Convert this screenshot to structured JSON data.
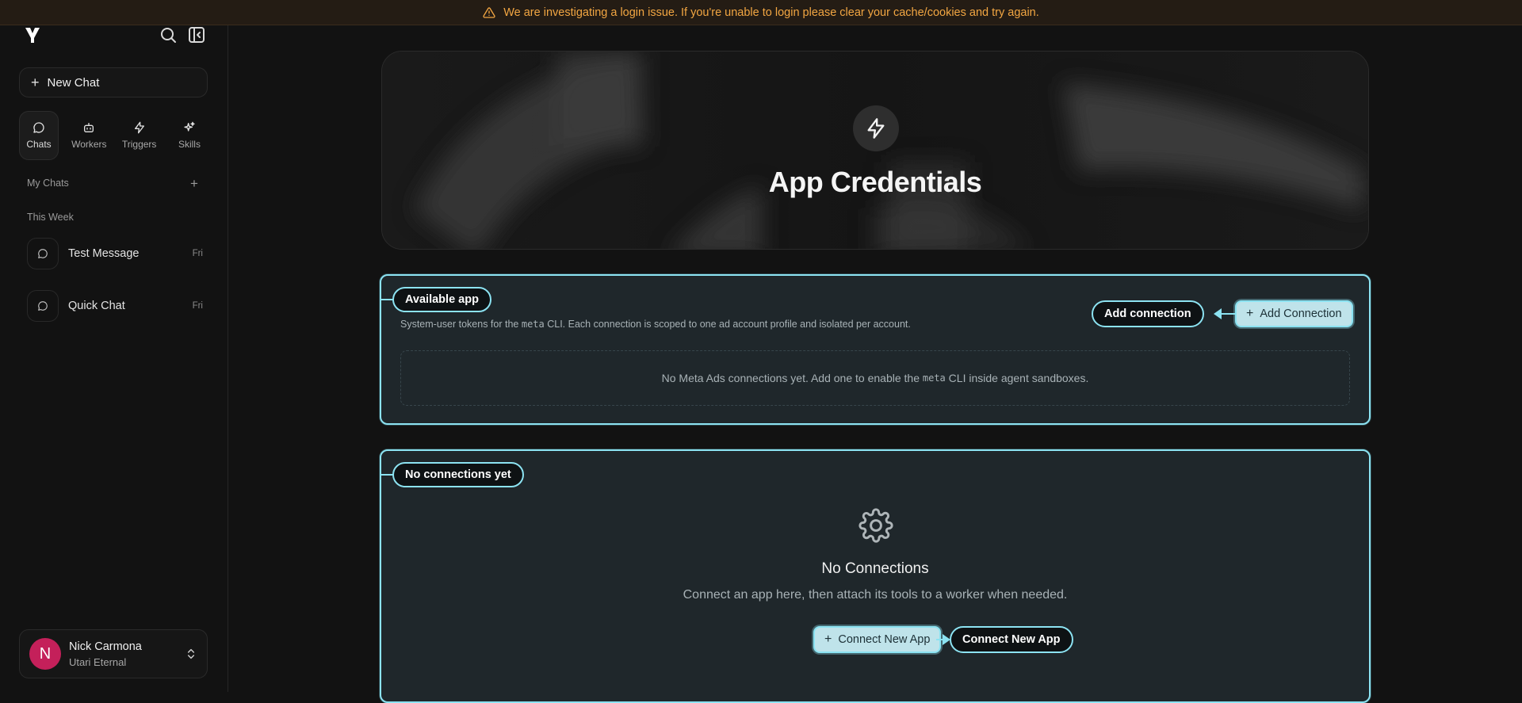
{
  "banner": {
    "text": "We are investigating a login issue. If you're unable to login please clear your cache/cookies and try again.",
    "color": "#f2a642"
  },
  "sidebar": {
    "new_chat_label": "New Chat",
    "nav": [
      {
        "label": "Chats",
        "icon": "chat-bubble-icon",
        "active": true
      },
      {
        "label": "Workers",
        "icon": "robot-icon"
      },
      {
        "label": "Triggers",
        "icon": "lightning-icon"
      },
      {
        "label": "Skills",
        "icon": "sparkles-icon"
      }
    ],
    "my_chats_label": "My Chats",
    "this_week_label": "This Week",
    "chats": [
      {
        "title": "Test Message",
        "time": "Fri"
      },
      {
        "title": "Quick Chat",
        "time": "Fri"
      }
    ],
    "user": {
      "initial": "N",
      "name": "Nick Carmona",
      "org": "Utari Eternal",
      "avatar_color": "#c4205a"
    }
  },
  "hero": {
    "title": "App Credentials",
    "icon": "lightning-icon"
  },
  "available_panel": {
    "tag": "Available app",
    "desc_pre": "System-user tokens for the ",
    "desc_code": "meta",
    "desc_post": " CLI. Each connection is scoped to one ad account profile and isolated per account.",
    "callout": "Add connection",
    "button_label": "Add Connection",
    "empty_pre": "No Meta Ads connections yet. Add one to enable the ",
    "empty_code": "meta",
    "empty_post": " CLI inside agent sandboxes."
  },
  "connections_panel": {
    "tag": "No connections yet",
    "title": "No Connections",
    "subtitle": "Connect an app here, then attach its tools to a worker when needed.",
    "button_label": "Connect New App",
    "callout": "Connect New App"
  },
  "accent_color": "#8ce3f2"
}
